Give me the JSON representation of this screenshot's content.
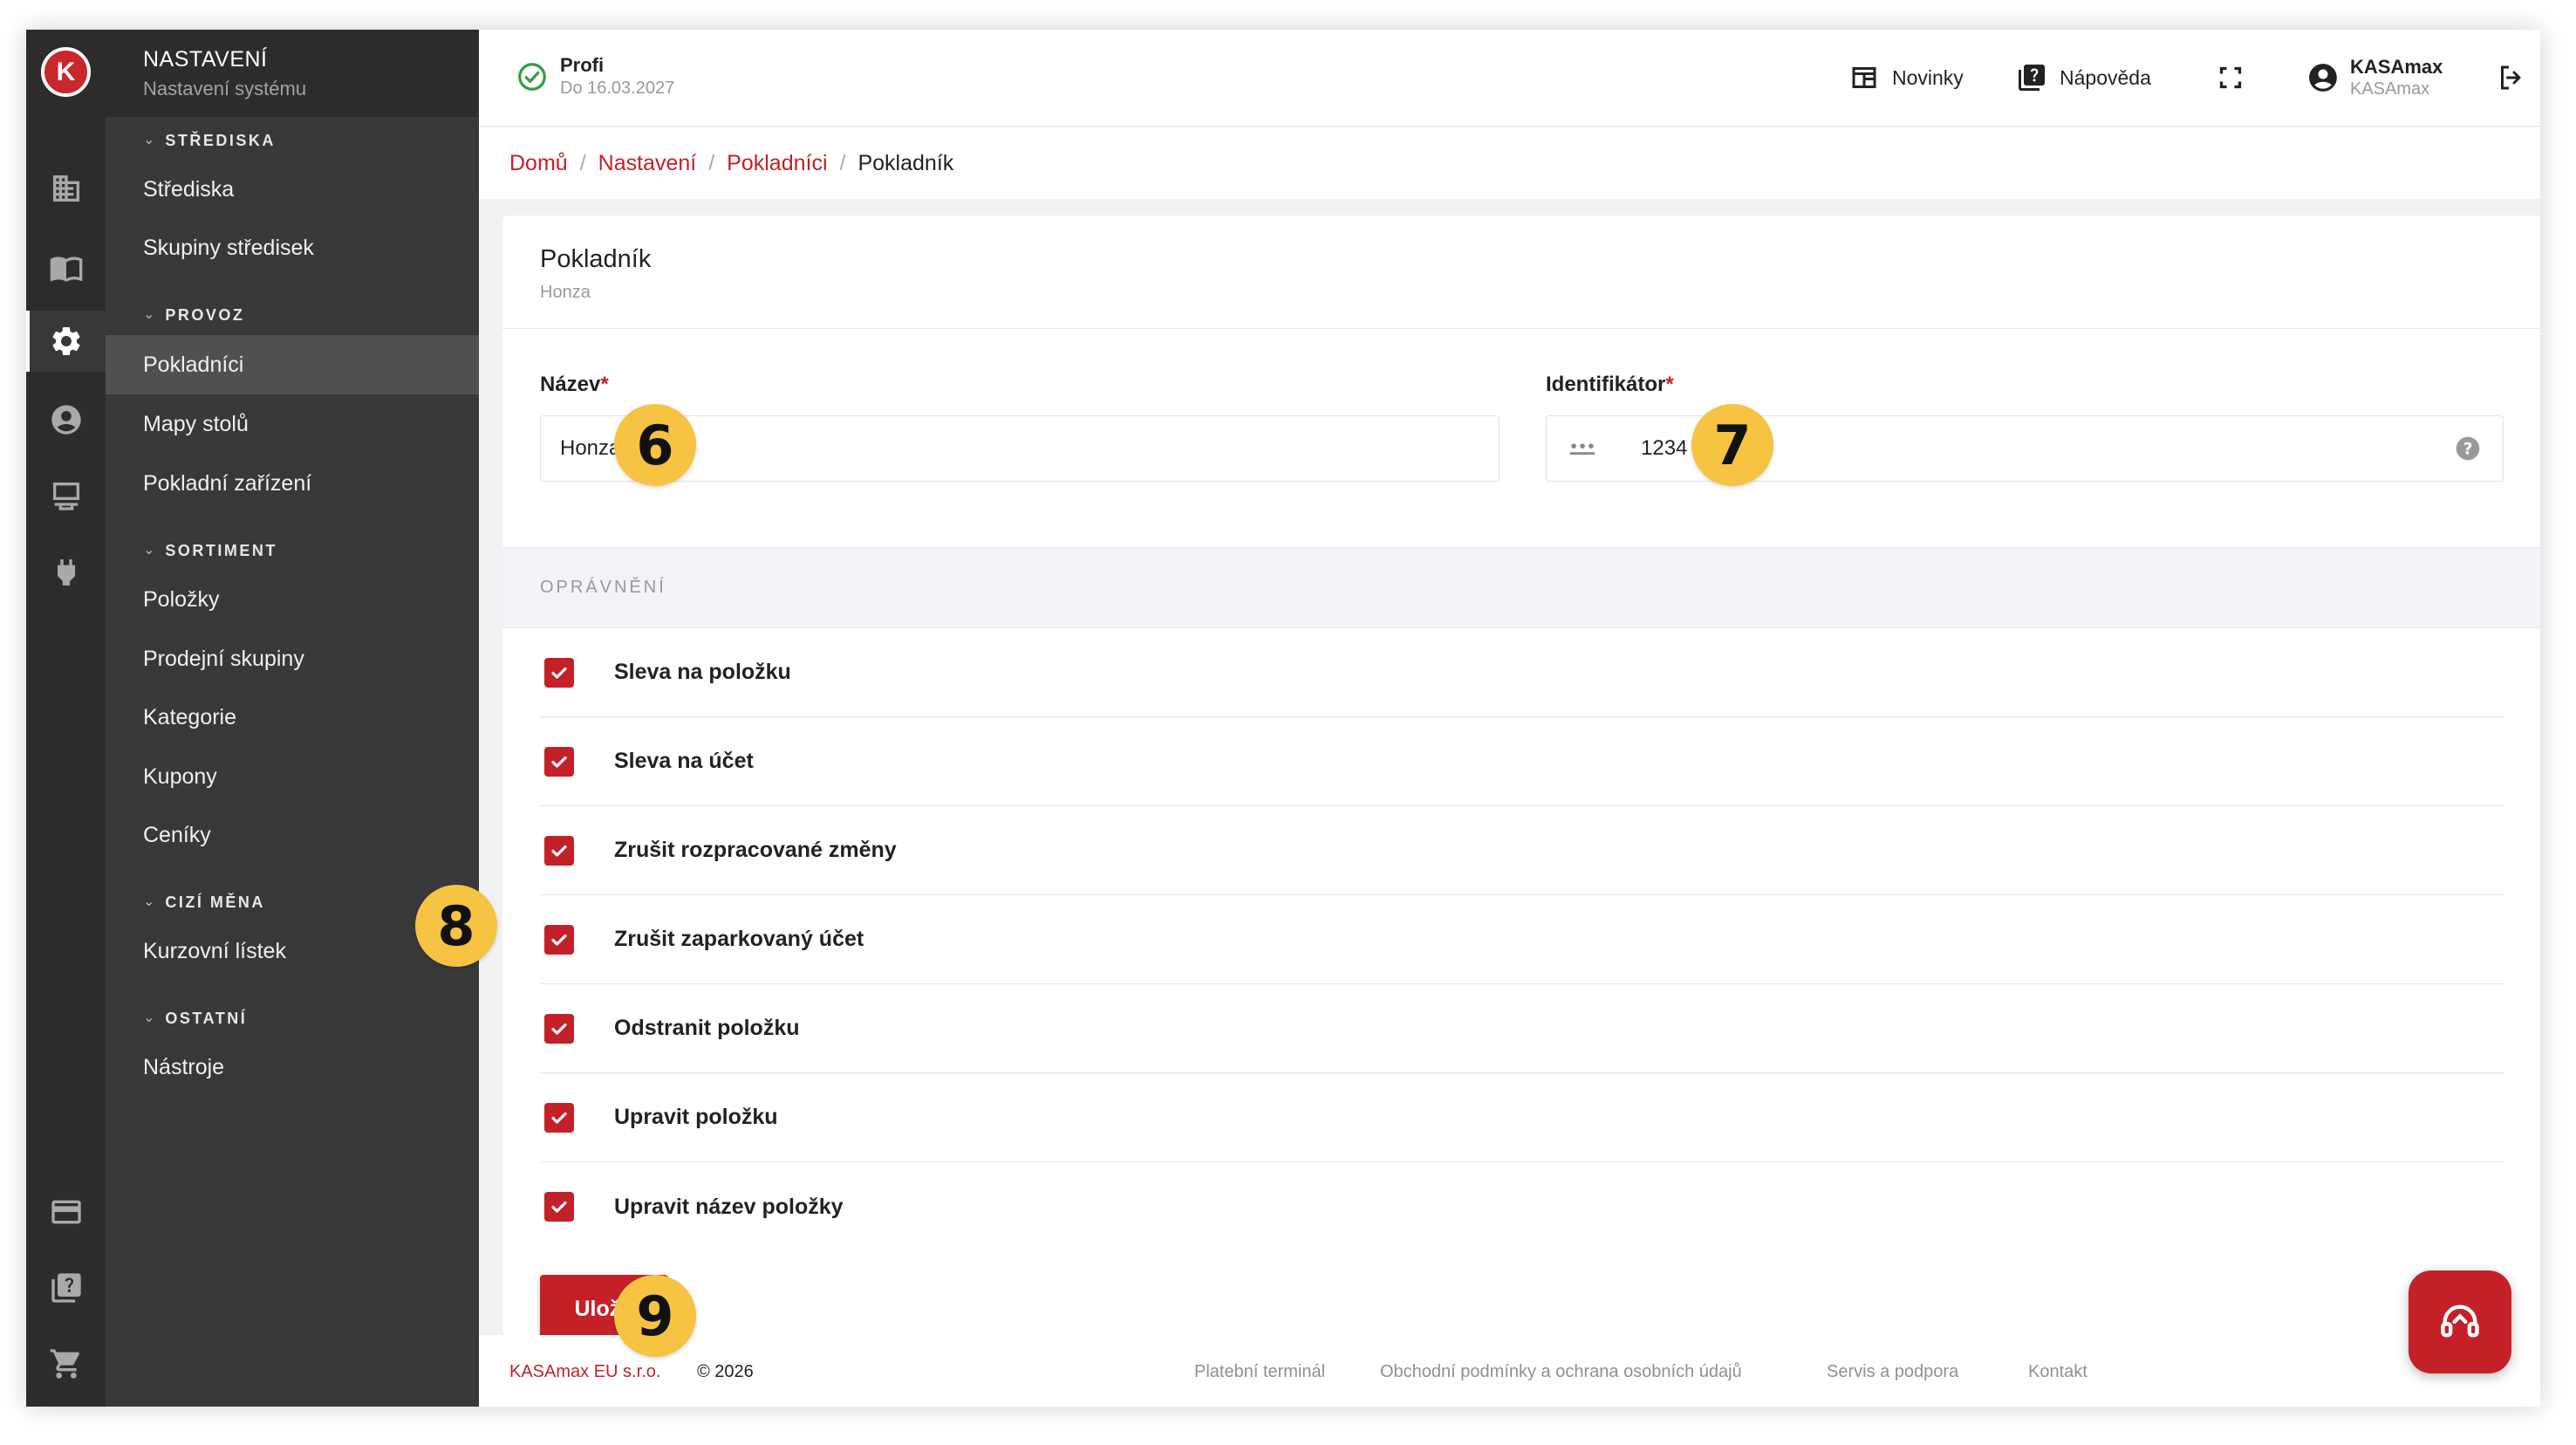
{
  "menu": {
    "title": "NASTAVENÍ",
    "subtitle": "Nastavení systému",
    "sections": [
      {
        "label": "STŘEDISKA",
        "items": [
          "Střediska",
          "Skupiny středisek"
        ]
      },
      {
        "label": "PROVOZ",
        "items": [
          "Pokladníci",
          "Mapy stolů",
          "Pokladní zařízení"
        ]
      },
      {
        "label": "SORTIMENT",
        "items": [
          "Položky",
          "Prodejní skupiny",
          "Kategorie",
          "Kupony",
          "Ceníky"
        ]
      },
      {
        "label": "CIZÍ MĚNA",
        "items": [
          "Kurzovní lístek"
        ]
      },
      {
        "label": "OSTATNÍ",
        "items": [
          "Nástroje"
        ]
      }
    ],
    "active_item": "Pokladníci"
  },
  "rail_icons": [
    "logo-icon",
    "building-icon",
    "book-icon",
    "gear-icon",
    "user-circle-icon",
    "pos-terminal-icon",
    "plug-icon",
    "credit-card-icon",
    "help-book-icon",
    "cart-icon"
  ],
  "topbar": {
    "plan_name": "Profi",
    "plan_valid": "Do 16.03.2027",
    "news_label": "Novinky",
    "help_label": "Nápověda",
    "user_name": "KASAmax",
    "user_sub": "KASAmax"
  },
  "breadcrumb": {
    "items": [
      "Domů",
      "Nastavení",
      "Pokladníci"
    ],
    "current": "Pokladník"
  },
  "card": {
    "title": "Pokladník",
    "subtitle": "Honza"
  },
  "form": {
    "name_label": "Název",
    "name_value": "Honza",
    "id_label": "Identifikátor",
    "id_value": "1234",
    "required_mark": "*"
  },
  "permissions": {
    "title": "OPRÁVNĚNÍ",
    "items": [
      {
        "label": "Sleva na položku",
        "checked": true
      },
      {
        "label": "Sleva na účet",
        "checked": true
      },
      {
        "label": "Zrušit rozpracované změny",
        "checked": true
      },
      {
        "label": "Zrušit zaparkovaný účet",
        "checked": true
      },
      {
        "label": "Odstranit položku",
        "checked": true
      },
      {
        "label": "Upravit položku",
        "checked": true
      },
      {
        "label": "Upravit název položky",
        "checked": true
      }
    ]
  },
  "save_label": "Uložit",
  "footer": {
    "company": "KASAmax EU s.r.o.",
    "copyright": "© 2026",
    "links": [
      "Platební terminál",
      "Obchodní podmínky a ochrana osobních údajů",
      "Servis a podpora",
      "Kontakt"
    ]
  },
  "badges": [
    "6",
    "7",
    "8",
    "9"
  ],
  "colors": {
    "accent": "#c32127",
    "sidebar": "#383838",
    "rail": "#2c2c2c",
    "badge": "#f6c343",
    "success": "#3a9b45"
  }
}
